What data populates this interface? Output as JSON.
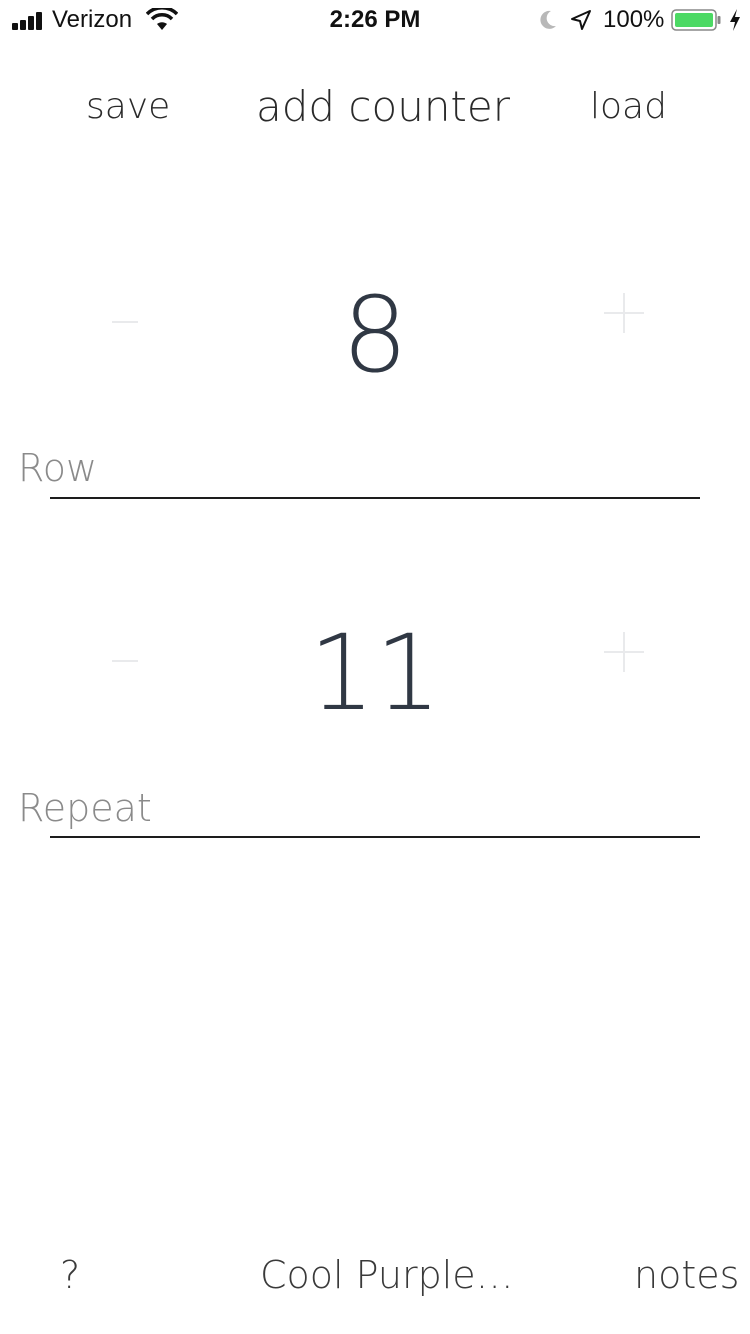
{
  "status_bar": {
    "carrier": "Verizon",
    "time": "2:26 PM",
    "battery_percent": "100%",
    "battery_color": "#4cd964",
    "icons": [
      "signal-icon",
      "wifi-icon",
      "moon-icon",
      "location-arrow-icon",
      "battery-icon",
      "charging-bolt-icon"
    ]
  },
  "toolbar": {
    "save_label": "save",
    "add_counter_label": "add counter",
    "load_label": "load"
  },
  "counters": [
    {
      "value": "8",
      "label": "Row",
      "minus": "−",
      "plus": "+"
    },
    {
      "value": "11",
      "label": "Repeat",
      "minus": "−",
      "plus": "+"
    }
  ],
  "bottom_bar": {
    "help_label": "?",
    "theme_label": "Cool Purple…",
    "notes_label": "notes"
  },
  "colors": {
    "counter_value": "#303844",
    "label": "#8a8a8a",
    "faint_controls": "#e9eaec",
    "underline": "#1d1d1d"
  }
}
